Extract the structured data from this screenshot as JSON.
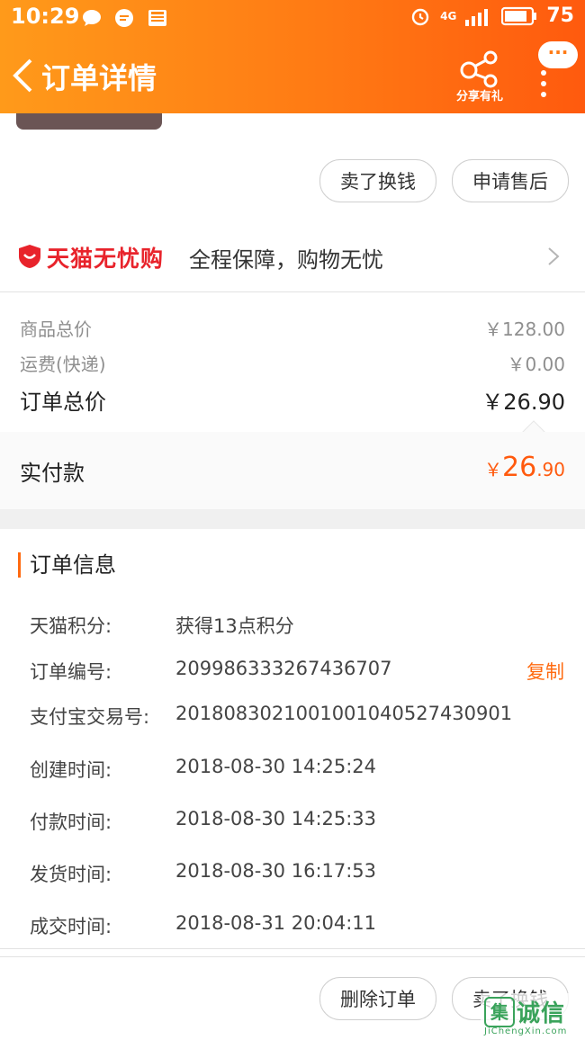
{
  "status_bar": {
    "time": "10:29",
    "network": "4G",
    "battery": "75"
  },
  "navbar": {
    "title": "订单详情",
    "share_label": "分享有礼",
    "more_bubble": "···"
  },
  "top_actions": {
    "sell": "卖了换钱",
    "after_sale": "申请售后"
  },
  "guarantee": {
    "brand": "天猫无忧购",
    "slogan": "全程保障，购物无忧"
  },
  "prices": {
    "goods_label": "商品总价",
    "goods_value": "￥128.00",
    "shipping_label": "运费(快递)",
    "shipping_value": "￥0.00",
    "order_total_label": "订单总价",
    "order_total_value": "￥26.90",
    "paid_label": "实付款",
    "paid_currency": "￥",
    "paid_int": "26",
    "paid_dec": ".90"
  },
  "order_info": {
    "title": "订单信息",
    "copy": "复制",
    "rows": [
      {
        "label": "天猫积分:",
        "value": "获得13点积分"
      },
      {
        "label": "订单编号:",
        "value": "209986333267436707"
      },
      {
        "label": "支付宝交易号:",
        "value": "2018083021001001040527430901"
      },
      {
        "label": "创建时间:",
        "value": "2018-08-30 14:25:24"
      },
      {
        "label": "付款时间:",
        "value": "2018-08-30 14:25:33"
      },
      {
        "label": "发货时间:",
        "value": "2018-08-30 16:17:53"
      },
      {
        "label": "成交时间:",
        "value": "2018-08-31 20:04:11"
      }
    ]
  },
  "bottom_actions": {
    "delete": "删除订单",
    "sell": "卖了换钱"
  },
  "watermark": {
    "logo": "集",
    "name": "诚信",
    "url": "JiChengXin.com"
  },
  "colors": {
    "accent": "#ff6a10",
    "brand_red": "#e8232b"
  }
}
